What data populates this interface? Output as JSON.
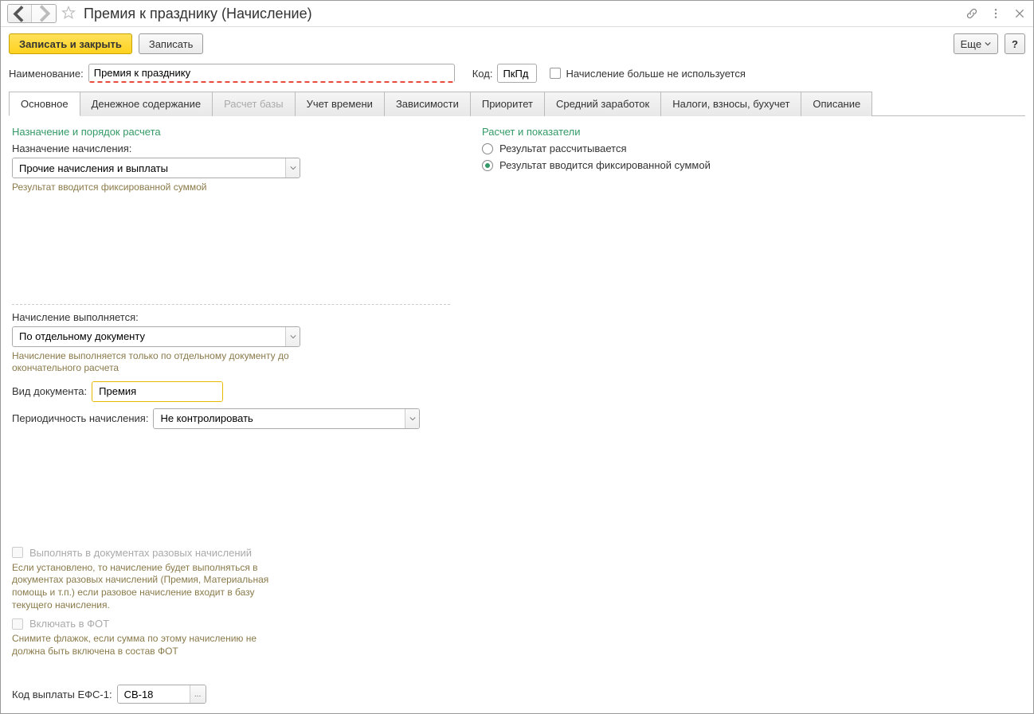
{
  "title": "Премия к празднику (Начисление)",
  "toolbar": {
    "save_close": "Записать и закрыть",
    "save": "Записать",
    "more": "Еще",
    "help": "?"
  },
  "header": {
    "name_label": "Наименование:",
    "name_value": "Премия к празднику",
    "code_label": "Код:",
    "code_value": "ПкПд",
    "not_used_label": "Начисление больше не используется"
  },
  "tabs": [
    {
      "label": "Основное",
      "active": true
    },
    {
      "label": "Денежное содержание"
    },
    {
      "label": "Расчет базы",
      "disabled": true
    },
    {
      "label": "Учет времени"
    },
    {
      "label": "Зависимости"
    },
    {
      "label": "Приоритет"
    },
    {
      "label": "Средний заработок"
    },
    {
      "label": "Налоги, взносы, бухучет"
    },
    {
      "label": "Описание"
    }
  ],
  "left": {
    "section1": "Назначение и порядок расчета",
    "purpose_label": "Назначение начисления:",
    "purpose_value": "Прочие начисления и выплаты",
    "purpose_hint": "Результат вводится фиксированной суммой",
    "exec_label": "Начисление выполняется:",
    "exec_value": "По отдельному документу",
    "exec_hint": "Начисление выполняется только по отдельному документу до окончательного расчета",
    "doc_label": "Вид документа:",
    "doc_value": "Премия",
    "period_label": "Периодичность начисления:",
    "period_value": "Не контролировать",
    "onetime_label": "Выполнять в документах разовых начислений",
    "onetime_hint": "Если установлено, то начисление будет выполняться в документах разовых начислений (Премия, Материальная помощь и т.п.) если разовое начисление входит в базу текущего начисления.",
    "fot_label": "Включать в ФОТ",
    "fot_hint": "Снимите флажок, если сумма по этому начислению не должна быть включена в состав ФОТ"
  },
  "right": {
    "section": "Расчет и показатели",
    "radio1": "Результат рассчитывается",
    "radio2": "Результат вводится фиксированной суммой"
  },
  "efs": {
    "label": "Код выплаты ЕФС-1:",
    "value": "СВ-18"
  }
}
